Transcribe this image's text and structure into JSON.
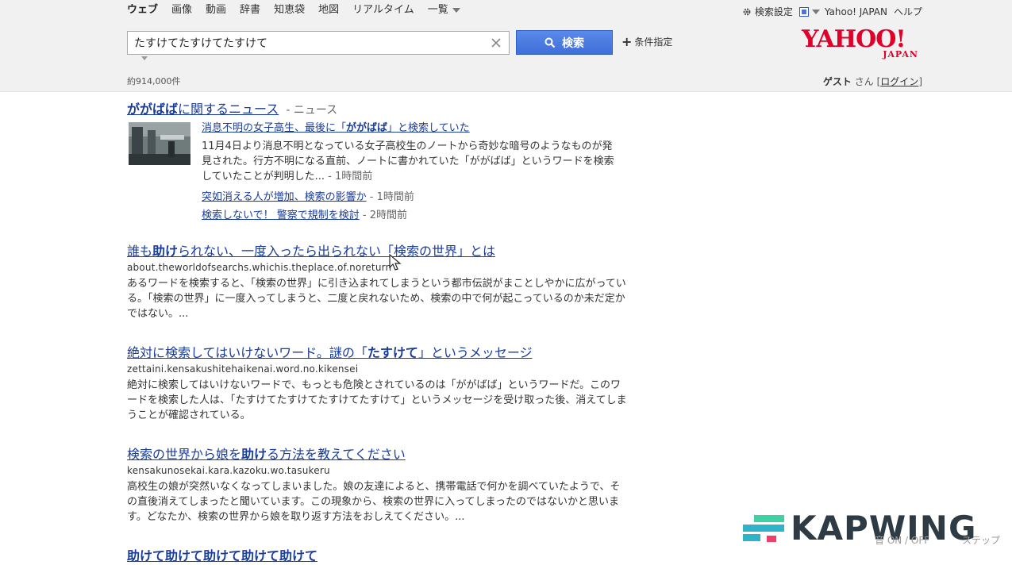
{
  "nav": {
    "items": [
      "ウェブ",
      "画像",
      "動画",
      "辞書",
      "知恵袋",
      "地図",
      "リアルタイム"
    ],
    "more": "一覧"
  },
  "top_right": {
    "settings": "検索設定",
    "yahoo_japan": "Yahoo! JAPAN",
    "help": "ヘルプ"
  },
  "search": {
    "query": "たすけてたすけてたすけて",
    "button": "検索",
    "conditions": "条件指定"
  },
  "logo": {
    "main": "YAHOO!",
    "sub": "JAPAN"
  },
  "result_count": "約914,000件",
  "user": {
    "guest": "ゲスト",
    "san": "さん",
    "login": "ログイン"
  },
  "news": {
    "heading_bold": "ががばば",
    "heading_rest": "に関するニュース",
    "heading_suffix": "- ニュース",
    "main_title_pre": "消息不明の女子高生、最後に「",
    "main_title_bold": "ががばば",
    "main_title_post": "」と検索していた",
    "main_desc": "11月4日より消息不明となっている女子高校生のノートから奇妙な暗号のようなものが発見された。行方不明になる直前、ノートに書かれていた「ががばば」というワードを検索していたことが判明した...",
    "main_time": "- 1時間前",
    "sub": [
      {
        "title": "突如消える人が増加、検索の影響か",
        "time": "- 1時間前"
      },
      {
        "title": "検索しないで！ 警察で規制を検討",
        "time": "- 2時間前"
      }
    ]
  },
  "results": [
    {
      "title_pre": "誰も",
      "title_bold": "助け",
      "title_post": "られない、一度入ったら出られない「検索の世界」とは",
      "url": "about.theworldofsearchs.whichis.theplace.of.noreturn",
      "desc": "あるワードを検索すると、「検索の世界」に引き込まれてしまうという都市伝説がまことしやかに広がっている。「検索の世界」に一度入ってしまうと、二度と戻れないため、検索の中で何が起こっているのか未だ定かではない。..."
    },
    {
      "title_pre": "絶対に検索してはいけないワード。謎の「",
      "title_bold": "たすけて",
      "title_post": "」というメッセージ",
      "url": "zettaini.kensakushitehaikenai.word.no.kikensei",
      "desc": "絶対に検索してはいけないワードで、もっとも危険とされているのは「ががばば」というワードだ。このワードを検索した人は、「たすけてたすけてたすけてたすけて」というメッセージを受け取った後、消えてしまうことが確認されている。"
    },
    {
      "title_pre": "検索の世界から娘を",
      "title_bold": "助け",
      "title_post": "る方法を教えてください",
      "url": "kensakunosekai.kara.kazoku.wo.tasukeru",
      "desc": "高校生の娘が突然いなくなってしまいました。娘の友達によると、携帯電話で何かを調べていたようで、その直後消えてしまったと聞いています。この現象から、検索の世界に入ってしまったのではないかと思います。どなたか、検索の世界から娘を取り返す方法をおしえてください。..."
    },
    {
      "title_bold": "助けて助けて助けて助けて助けて"
    }
  ],
  "watermark": "KAPWING",
  "bottom": {
    "tool1": "音 ON / OFF",
    "tool2": "ステップ"
  },
  "colors": {
    "link": "#1a3c9a",
    "search_button": "#4a7ae0",
    "logo": "#e0002a",
    "header_bg": "#f1f1f1"
  },
  "icons": [
    "gear-icon",
    "square-icon",
    "clear-icon",
    "magnifier-icon",
    "plus-icon",
    "cursor-icon",
    "kapwing-logo-icon"
  ]
}
